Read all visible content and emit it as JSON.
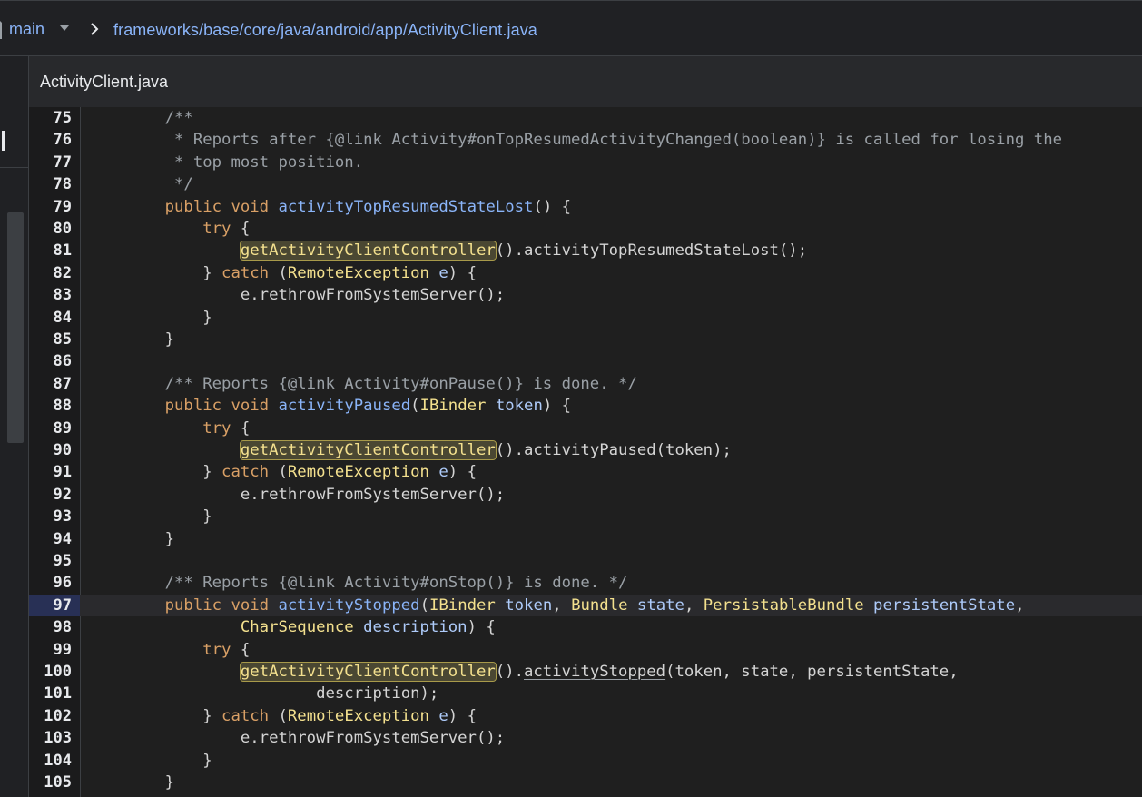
{
  "header": {
    "branch": "main",
    "path": "frameworks/base/core/java/android/app/ActivityClient.java"
  },
  "tab": {
    "title": "ActivityClient.java"
  },
  "editor": {
    "current_line": "97",
    "lines": [
      {
        "num": "75",
        "text": "    /**"
      },
      {
        "num": "76",
        "text": "     * Reports after {@link Activity#onTopResumedActivityChanged(boolean)} is called for losing the"
      },
      {
        "num": "77",
        "text": "     * top most position."
      },
      {
        "num": "78",
        "text": "     */"
      },
      {
        "num": "79",
        "text": "    public void activityTopResumedStateLost() {"
      },
      {
        "num": "80",
        "text": "        try {"
      },
      {
        "num": "81",
        "text": "            getActivityClientController().activityTopResumedStateLost();"
      },
      {
        "num": "82",
        "text": "        } catch (RemoteException e) {"
      },
      {
        "num": "83",
        "text": "            e.rethrowFromSystemServer();"
      },
      {
        "num": "84",
        "text": "        }"
      },
      {
        "num": "85",
        "text": "    }"
      },
      {
        "num": "86",
        "text": ""
      },
      {
        "num": "87",
        "text": "    /** Reports {@link Activity#onPause()} is done. */"
      },
      {
        "num": "88",
        "text": "    public void activityPaused(IBinder token) {"
      },
      {
        "num": "89",
        "text": "        try {"
      },
      {
        "num": "90",
        "text": "            getActivityClientController().activityPaused(token);"
      },
      {
        "num": "91",
        "text": "        } catch (RemoteException e) {"
      },
      {
        "num": "92",
        "text": "            e.rethrowFromSystemServer();"
      },
      {
        "num": "93",
        "text": "        }"
      },
      {
        "num": "94",
        "text": "    }"
      },
      {
        "num": "95",
        "text": ""
      },
      {
        "num": "96",
        "text": "    /** Reports {@link Activity#onStop()} is done. */"
      },
      {
        "num": "97",
        "text": "    public void activityStopped(IBinder token, Bundle state, PersistableBundle persistentState,"
      },
      {
        "num": "98",
        "text": "            CharSequence description) {"
      },
      {
        "num": "99",
        "text": "        try {"
      },
      {
        "num": "100",
        "text": "            getActivityClientController().activityStopped(token, state, persistentState,"
      },
      {
        "num": "101",
        "text": "                    description);"
      },
      {
        "num": "102",
        "text": "        } catch (RemoteException e) {"
      },
      {
        "num": "103",
        "text": "            e.rethrowFromSystemServer();"
      },
      {
        "num": "104",
        "text": "        }"
      },
      {
        "num": "105",
        "text": "    }"
      }
    ]
  },
  "colors": {
    "keyword": "#d9a066",
    "type": "#f3e08e",
    "function": "#8ab4f8",
    "comment": "#9aa0a6",
    "highlight": "#4a4732",
    "link": "#8ab4f8"
  }
}
